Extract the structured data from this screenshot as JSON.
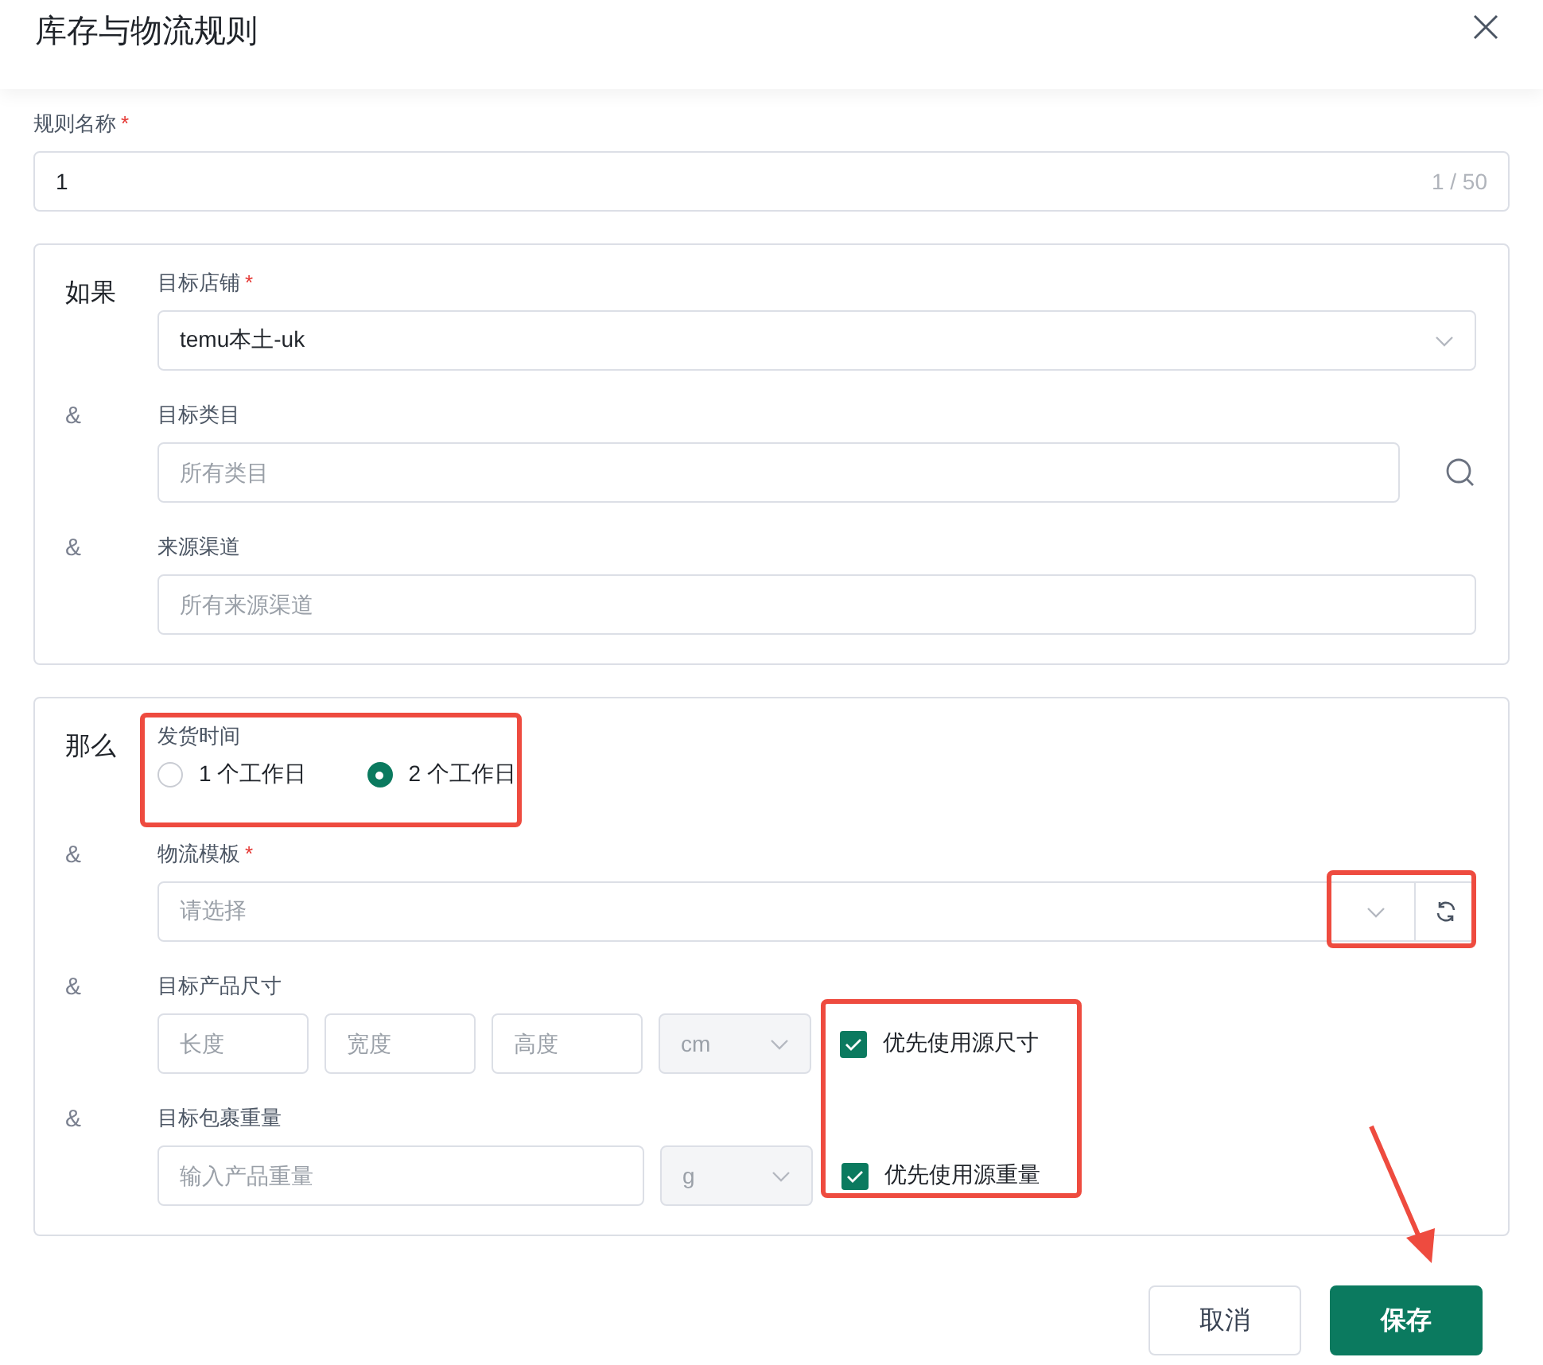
{
  "dialog": {
    "title": "库存与物流规则"
  },
  "required_mark": "*",
  "rule_name": {
    "label": "规则名称",
    "required": true,
    "value": "1",
    "counter": "1 / 50"
  },
  "condition": {
    "heading": "如果",
    "fields": [
      {
        "kind": "select",
        "label": "目标店铺",
        "required": true,
        "value": "temu本土-uk"
      },
      {
        "kind": "search",
        "prefix": "&",
        "label": "目标类目",
        "required": false,
        "placeholder": "所有类目"
      },
      {
        "kind": "text",
        "prefix": "&",
        "label": "来源渠道",
        "required": false,
        "placeholder": "所有来源渠道"
      }
    ]
  },
  "action": {
    "heading": "那么",
    "fields": [
      {
        "kind": "radio",
        "label": "发货时间",
        "required": false,
        "options": [
          {
            "label": "1 个工作日",
            "selected": false
          },
          {
            "label": "2 个工作日",
            "selected": true
          }
        ]
      },
      {
        "kind": "refresh-select",
        "prefix": "&",
        "label": "物流模板",
        "required": true,
        "placeholder": "请选择"
      },
      {
        "kind": "dimensions",
        "prefix": "&",
        "label": "目标产品尺寸",
        "required": false,
        "placeholders": [
          "长度",
          "宽度",
          "高度"
        ],
        "unit": "cm",
        "unit_disabled": true,
        "option": {
          "label": "优先使用源尺寸",
          "checked": true
        }
      },
      {
        "kind": "weight",
        "prefix": "&",
        "label": "目标包裹重量",
        "required": false,
        "placeholders": [
          "输入产品重量"
        ],
        "unit": "g",
        "unit_disabled": true,
        "option": {
          "label": "优先使用源重量",
          "checked": true
        }
      }
    ]
  },
  "buttons": [
    {
      "label": "取消",
      "primary": false
    },
    {
      "label": "保存",
      "primary": true
    }
  ]
}
